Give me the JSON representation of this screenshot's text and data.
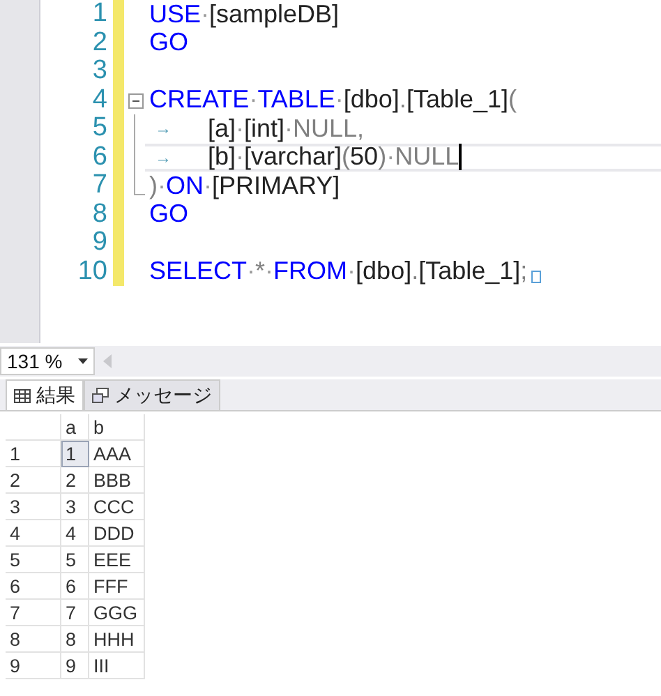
{
  "editor": {
    "lines": [
      {
        "number": "1",
        "collapsible": false,
        "in_region": false,
        "current": false,
        "tokens": [
          {
            "kind": "keyword",
            "text": "USE"
          },
          {
            "kind": "space",
            "text": "·"
          },
          {
            "kind": "plain",
            "text": "[sampleDB]"
          }
        ]
      },
      {
        "number": "2",
        "collapsible": false,
        "in_region": false,
        "current": false,
        "tokens": [
          {
            "kind": "keyword",
            "text": "GO"
          }
        ]
      },
      {
        "number": "3",
        "collapsible": false,
        "in_region": false,
        "current": false
      },
      {
        "number": "4",
        "collapsible": true,
        "in_region": false,
        "current": false,
        "tokens": [
          {
            "kind": "keyword",
            "text": "CREATE"
          },
          {
            "kind": "space",
            "text": "·"
          },
          {
            "kind": "keyword",
            "text": "TABLE"
          },
          {
            "kind": "space",
            "text": "·"
          },
          {
            "kind": "plain",
            "text": "[dbo]"
          },
          {
            "kind": "gray",
            "text": "."
          },
          {
            "kind": "plain",
            "text": "[Table_1]"
          },
          {
            "kind": "gray",
            "text": "("
          }
        ]
      },
      {
        "number": "5",
        "collapsible": false,
        "in_region": true,
        "current": false,
        "tokens": [
          {
            "kind": "tab",
            "text": "→"
          },
          {
            "kind": "plain",
            "text": "[a]"
          },
          {
            "kind": "space",
            "text": "·"
          },
          {
            "kind": "plain",
            "text": "[int]"
          },
          {
            "kind": "space",
            "text": "·"
          },
          {
            "kind": "gray",
            "text": "NULL,"
          }
        ]
      },
      {
        "number": "6",
        "collapsible": false,
        "in_region": true,
        "current": true,
        "tokens": [
          {
            "kind": "tab",
            "text": "→"
          },
          {
            "kind": "plain",
            "text": "[b]"
          },
          {
            "kind": "space",
            "text": "·"
          },
          {
            "kind": "plain",
            "text": "[varchar]"
          },
          {
            "kind": "gray",
            "text": "("
          },
          {
            "kind": "plain",
            "text": "50"
          },
          {
            "kind": "gray",
            "text": ")"
          },
          {
            "kind": "space",
            "text": "·"
          },
          {
            "kind": "gray",
            "text": "NULL"
          }
        ]
      },
      {
        "number": "7",
        "collapsible": false,
        "in_region": true,
        "current": false,
        "tokens": [
          {
            "kind": "gray",
            "text": ")"
          },
          {
            "kind": "space",
            "text": "·"
          },
          {
            "kind": "keyword",
            "text": "ON"
          },
          {
            "kind": "space",
            "text": "·"
          },
          {
            "kind": "plain",
            "text": "[PRIMARY]"
          }
        ]
      },
      {
        "number": "8",
        "collapsible": false,
        "in_region": false,
        "current": false,
        "tokens": [
          {
            "kind": "keyword",
            "text": "GO"
          }
        ]
      },
      {
        "number": "9",
        "collapsible": false,
        "in_region": false,
        "current": false
      },
      {
        "number": "10",
        "collapsible": false,
        "in_region": false,
        "current": false,
        "tokens": [
          {
            "kind": "keyword",
            "text": "SELECT"
          },
          {
            "kind": "space",
            "text": "·"
          },
          {
            "kind": "gray",
            "text": "*"
          },
          {
            "kind": "space",
            "text": "·"
          },
          {
            "kind": "keyword",
            "text": "FROM"
          },
          {
            "kind": "space",
            "text": "·"
          },
          {
            "kind": "plain",
            "text": "[dbo]"
          },
          {
            "kind": "gray",
            "text": "."
          },
          {
            "kind": "plain",
            "text": "[Table_1]"
          },
          {
            "kind": "gray",
            "text": ";"
          }
        ]
      }
    ]
  },
  "zoom": {
    "value": "131 %"
  },
  "tabs": [
    {
      "label": "結果",
      "kind": "grid",
      "selected": true
    },
    {
      "label": "メッセージ",
      "kind": "message",
      "selected": false
    }
  ],
  "grid": {
    "columns": [
      "a",
      "b"
    ],
    "rows": [
      {
        "number": "1",
        "cells": [
          {
            "text": "1",
            "selected": true
          },
          {
            "text": "AAA",
            "selected": false
          }
        ]
      },
      {
        "number": "2",
        "cells": [
          {
            "text": "2",
            "selected": false
          },
          {
            "text": "BBB",
            "selected": false
          }
        ]
      },
      {
        "number": "3",
        "cells": [
          {
            "text": "3",
            "selected": false
          },
          {
            "text": "CCC",
            "selected": false
          }
        ]
      },
      {
        "number": "4",
        "cells": [
          {
            "text": "4",
            "selected": false
          },
          {
            "text": "DDD",
            "selected": false
          }
        ]
      },
      {
        "number": "5",
        "cells": [
          {
            "text": "5",
            "selected": false
          },
          {
            "text": "EEE",
            "selected": false
          }
        ]
      },
      {
        "number": "6",
        "cells": [
          {
            "text": "6",
            "selected": false
          },
          {
            "text": "FFF",
            "selected": false
          }
        ]
      },
      {
        "number": "7",
        "cells": [
          {
            "text": "7",
            "selected": false
          },
          {
            "text": "GGG",
            "selected": false
          }
        ]
      },
      {
        "number": "8",
        "cells": [
          {
            "text": "8",
            "selected": false
          },
          {
            "text": "HHH",
            "selected": false
          }
        ]
      },
      {
        "number": "9",
        "cells": [
          {
            "text": "9",
            "selected": false
          },
          {
            "text": "III",
            "selected": false
          }
        ]
      }
    ]
  }
}
